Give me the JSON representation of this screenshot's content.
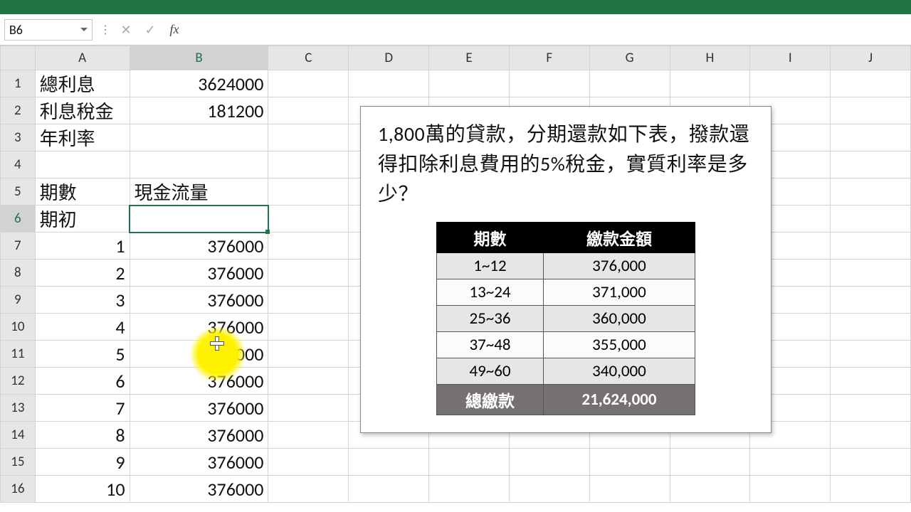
{
  "active_cell": "B6",
  "formula_bar_value": "",
  "columns": [
    "A",
    "B",
    "C",
    "D",
    "E",
    "F",
    "G",
    "H",
    "I",
    "J"
  ],
  "row_count": 16,
  "selected_col": "B",
  "selected_row": 6,
  "cells": {
    "A1": "總利息",
    "B1": "3624000",
    "A2": "利息稅金",
    "B2": "181200",
    "A3": "年利率",
    "A5": "期數",
    "B5": "現金流量",
    "A6": "期初",
    "A7": "1",
    "B7": "376000",
    "A8": "2",
    "B8": "376000",
    "A9": "3",
    "B9": "376000",
    "A10": "4",
    "B10": "376000",
    "A11": "5",
    "B11": "376000",
    "A12": "6",
    "B12": "376000",
    "A13": "7",
    "B13": "376000",
    "A14": "8",
    "B14": "376000",
    "A15": "9",
    "B15": "376000",
    "A16": "10",
    "B16": "376000"
  },
  "left_align": [
    "A1",
    "A2",
    "A3",
    "A5",
    "A6",
    "B5"
  ],
  "callout_text": "1,800萬的貸款，分期還款如下表，撥款還得扣除利息費用的5%稅金，實質利率是多少？",
  "pay_table": {
    "headers": [
      "期數",
      "繳款金額"
    ],
    "rows": [
      {
        "period": "1~12",
        "amount": "376,000",
        "cls": "odd"
      },
      {
        "period": "13~24",
        "amount": "371,000",
        "cls": "even"
      },
      {
        "period": "25~36",
        "amount": "360,000",
        "cls": "odd"
      },
      {
        "period": "37~48",
        "amount": "355,000",
        "cls": "even"
      },
      {
        "period": "49~60",
        "amount": "340,000",
        "cls": "odd"
      }
    ],
    "total_label": "總繳款",
    "total_value": "21,624,000"
  }
}
